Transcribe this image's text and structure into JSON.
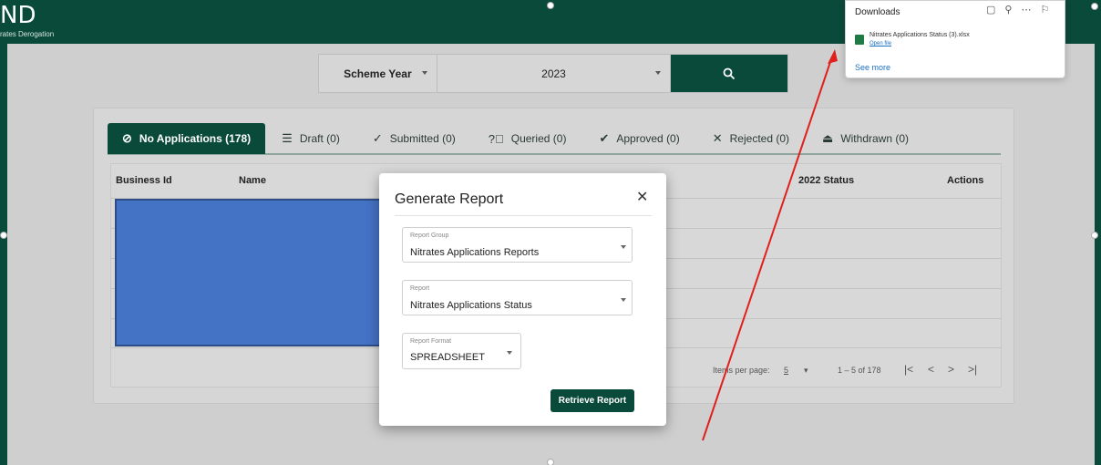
{
  "header": {
    "logo_text": "ND",
    "subtitle": "rates Derogation"
  },
  "search": {
    "scheme_year_label": "Scheme Year",
    "year_value": "2023"
  },
  "tabs": [
    {
      "label": "No Applications (178)",
      "icon": "ban-icon",
      "active": true
    },
    {
      "label": "Draft (0)",
      "icon": "lines-icon",
      "active": false
    },
    {
      "label": "Submitted (0)",
      "icon": "check-icon",
      "active": false
    },
    {
      "label": "Queried (0)",
      "icon": "question-icon",
      "active": false
    },
    {
      "label": "Approved (0)",
      "icon": "double-check-icon",
      "active": false
    },
    {
      "label": "Rejected (0)",
      "icon": "x-icon",
      "active": false
    },
    {
      "label": "Withdrawn (0)",
      "icon": "eject-icon",
      "active": false
    }
  ],
  "table": {
    "columns": [
      "Business Id",
      "Name",
      "2022 Status",
      "Actions"
    ],
    "paginator": {
      "items_per_page_label": "Items per page:",
      "items_per_page_value": "5",
      "range": "1 – 5 of 178"
    }
  },
  "modal": {
    "title": "Generate Report",
    "report_group_label": "Report Group",
    "report_group_value": "Nitrates Applications Reports",
    "report_label": "Report",
    "report_value": "Nitrates Applications Status",
    "format_label": "Report Format",
    "format_value": "SPREADSHEET",
    "retrieve_label": "Retrieve Report"
  },
  "downloads": {
    "title": "Downloads",
    "file_name": "Nitrates Applications Status (3).xlsx",
    "open_file": "Open file",
    "see_more": "See more"
  },
  "colors": {
    "brand": "#0a4a3a",
    "highlight": "#4472c4",
    "arrow": "#e0201c"
  }
}
